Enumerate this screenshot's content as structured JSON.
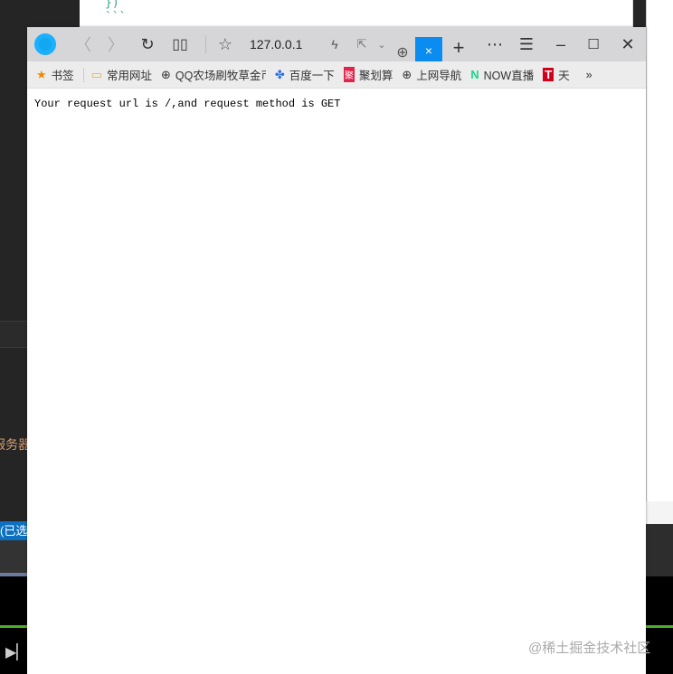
{
  "background_editor": {
    "code_lines": [
      "})",
      "```"
    ],
    "side_text": "服务器",
    "selection_text": "(已选择"
  },
  "browser": {
    "url": "127.0.0.1",
    "bookmarks": [
      {
        "label": "书签",
        "icon": "star-icon"
      },
      {
        "label": "常用网址",
        "icon": "folder-icon"
      },
      {
        "label": "QQ农场刷牧草金币",
        "icon": "globe-icon"
      },
      {
        "label": "百度一下",
        "icon": "baidu-icon"
      },
      {
        "label": "聚划算",
        "icon": "juhuasuan-icon"
      },
      {
        "label": "上网导航",
        "icon": "globe-icon"
      },
      {
        "label": "NOW直播",
        "icon": "now-icon"
      },
      {
        "label": "天",
        "icon": "tmall-icon"
      }
    ],
    "more_bookmarks": "»",
    "page_text": "Your request url is /,and request method is GET"
  },
  "watermark": "@稀土掘金技术社区"
}
